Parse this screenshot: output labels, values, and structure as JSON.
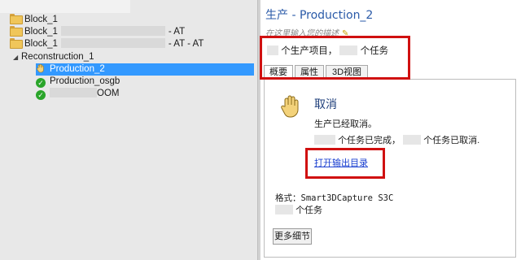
{
  "tree": {
    "items": [
      {
        "label": "Block_1",
        "suffix": ""
      },
      {
        "label": "Block_1",
        "suffix": "- AT"
      },
      {
        "label": "Block_1",
        "suffix": "- AT - AT"
      }
    ],
    "reconstruction": {
      "label": "Reconstruction_1",
      "children": [
        {
          "label": "Production_2",
          "status": "cancelled"
        },
        {
          "label": "Production_osgb",
          "status": "complete"
        },
        {
          "label": "OOM",
          "status": "complete"
        }
      ]
    }
  },
  "detail": {
    "title": "生产 - Production_2",
    "description_placeholder": "在这里输入您的描述",
    "summary": {
      "projects_text": "个生产项目，",
      "tasks_text": "个任务"
    },
    "tabs": [
      "概要",
      "属性",
      "3D视图"
    ],
    "active_tab": "概要",
    "status": {
      "heading": "取消",
      "line1": "生产已经取消。",
      "completed_text": "个任务已完成，",
      "cancelled_text": "个任务已取消."
    },
    "open_output_link": "打开输出目录",
    "format_line": "格式：Smart3DCapture S3C",
    "format_tasks_text": "个任务",
    "more_details_button": "更多细节"
  },
  "colors": {
    "selection": "#3399ff",
    "highlight_box": "#d01010",
    "title": "#2a5aa8",
    "link": "#1a3fd0"
  }
}
